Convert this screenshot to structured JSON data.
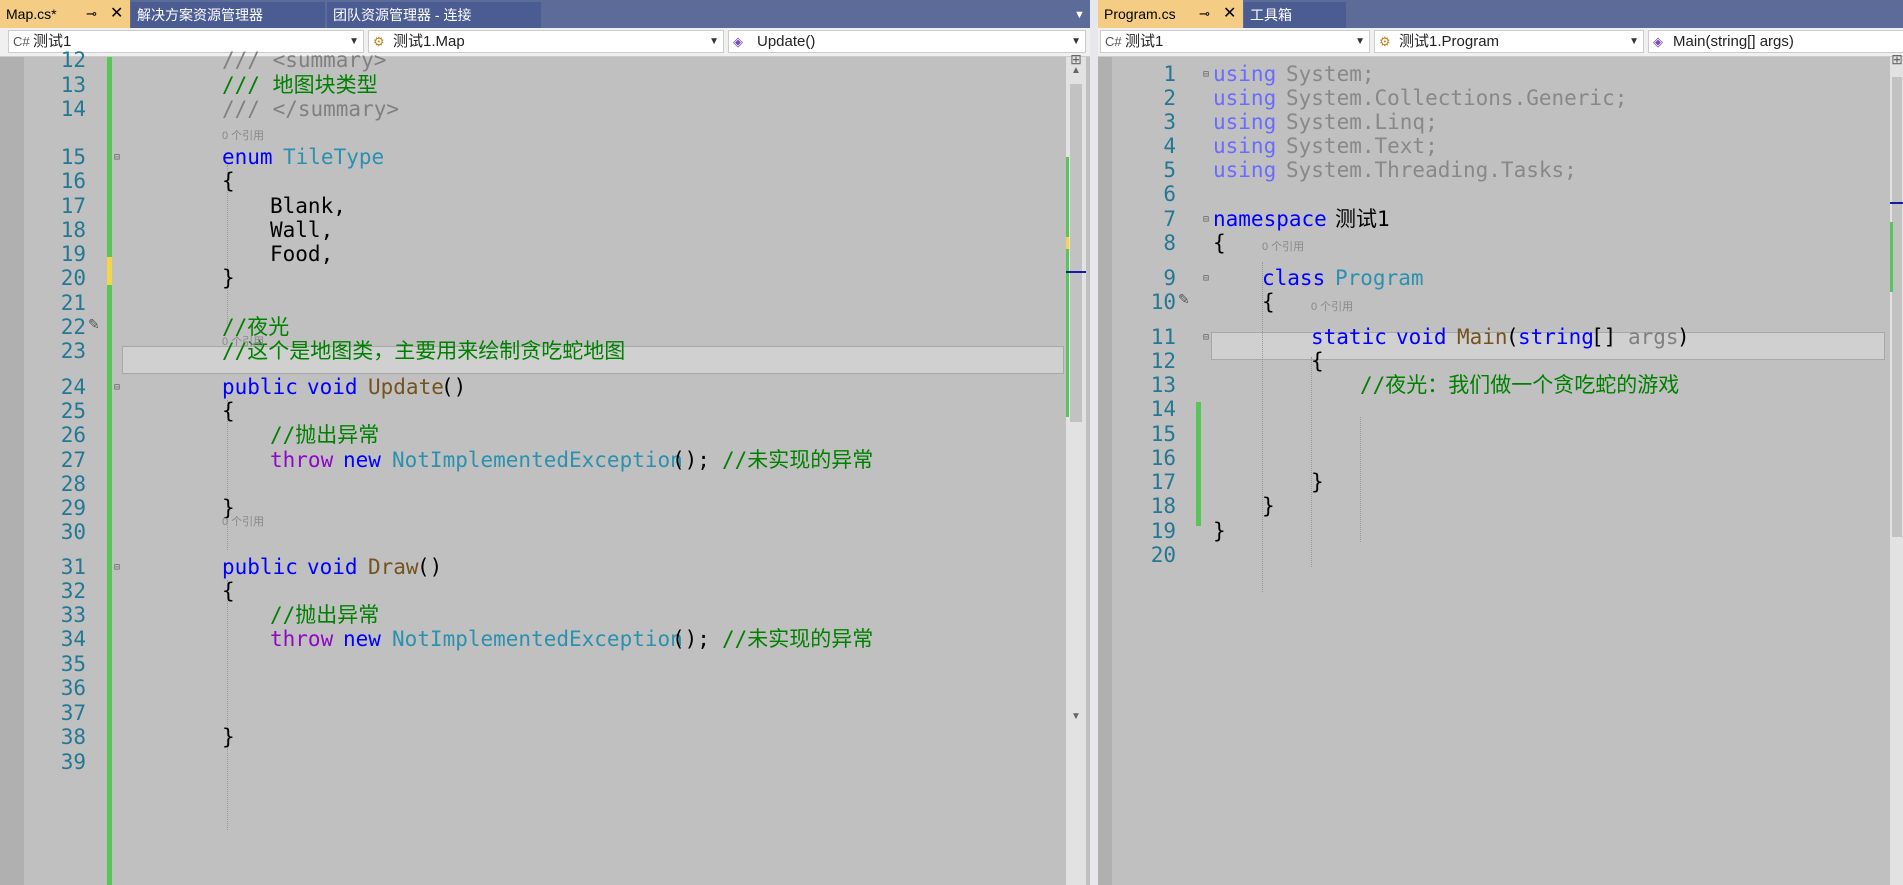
{
  "left_pane": {
    "tabs": [
      {
        "label": "Map.cs*",
        "active": true
      },
      {
        "label": "解决方案资源管理器",
        "active": false
      },
      {
        "label": "团队资源管理器 - 连接",
        "active": false
      }
    ],
    "nav": {
      "project": "测试1",
      "class": "测试1.Map",
      "member": "Update()"
    },
    "lines": [
      {
        "n": "12",
        "text": "/// <summary>"
      },
      {
        "n": "13",
        "text": "/// 地图块类型"
      },
      {
        "n": "14",
        "text": "/// </summary>"
      },
      {
        "n": "15",
        "lens": "0 个引用",
        "kw": "enum",
        "name": "TileType"
      },
      {
        "n": "16",
        "text": "{"
      },
      {
        "n": "17",
        "text": "Blank,"
      },
      {
        "n": "18",
        "text": "Wall,"
      },
      {
        "n": "19",
        "text": "Food,"
      },
      {
        "n": "20",
        "text": "}"
      },
      {
        "n": "21",
        "text": ""
      },
      {
        "n": "22",
        "text": "//夜光"
      },
      {
        "n": "23",
        "text": "//这个是地图类，主要用来绘制贪吃蛇地图"
      },
      {
        "n": "24",
        "lens": "0 个引用",
        "kw1": "public",
        "kw2": "void",
        "fn": "Update",
        "rest": "()"
      },
      {
        "n": "25",
        "text": "{"
      },
      {
        "n": "26",
        "text": "//抛出异常"
      },
      {
        "n": "27",
        "ctl": "throw",
        "kw": "new",
        "ty": "NotImplementedException",
        "rest": "();",
        "cm": "//未实现的异常"
      },
      {
        "n": "28",
        "text": ""
      },
      {
        "n": "29",
        "text": "}"
      },
      {
        "n": "30",
        "text": ""
      },
      {
        "n": "31",
        "lens": "0 个引用",
        "kw1": "public",
        "kw2": "void",
        "fn": "Draw",
        "rest": "()"
      },
      {
        "n": "32",
        "text": "{"
      },
      {
        "n": "33",
        "text": "//抛出异常"
      },
      {
        "n": "34",
        "ctl": "throw",
        "kw": "new",
        "ty": "NotImplementedException",
        "rest": "();",
        "cm": "//未实现的异常"
      },
      {
        "n": "35",
        "text": ""
      },
      {
        "n": "36",
        "text": ""
      },
      {
        "n": "37",
        "text": ""
      },
      {
        "n": "38",
        "text": "}"
      },
      {
        "n": "39",
        "text": ""
      }
    ]
  },
  "right_pane": {
    "tabs": [
      {
        "label": "Program.cs",
        "active": true
      },
      {
        "label": "工具箱",
        "active": false
      }
    ],
    "nav": {
      "project": "测试1",
      "class": "测试1.Program",
      "member": "Main(string[] args)"
    },
    "lines": [
      {
        "n": "1",
        "kw": "using",
        "rest": "System;"
      },
      {
        "n": "2",
        "kw": "using",
        "rest": "System.Collections.Generic;"
      },
      {
        "n": "3",
        "kw": "using",
        "rest": "System.Linq;"
      },
      {
        "n": "4",
        "kw": "using",
        "rest": "System.Text;"
      },
      {
        "n": "5",
        "kw": "using",
        "rest": "System.Threading.Tasks;"
      },
      {
        "n": "6",
        "text": ""
      },
      {
        "n": "7",
        "kw": "namespace",
        "rest": "测试1"
      },
      {
        "n": "8",
        "text": "{"
      },
      {
        "n": "9",
        "lens": "0 个引用",
        "kw": "class",
        "ty": "Program"
      },
      {
        "n": "10",
        "text": "{"
      },
      {
        "n": "11",
        "lens": "0 个引用",
        "kw1": "static",
        "kw2": "void",
        "fn": "Main",
        "p1": "(",
        "kw3": "string",
        "p2": "[]",
        "arg": "args",
        "p3": ")"
      },
      {
        "n": "12",
        "text": "{"
      },
      {
        "n": "13",
        "text": "//夜光：我们做一个贪吃蛇的游戏"
      },
      {
        "n": "14",
        "text": ""
      },
      {
        "n": "15",
        "text": ""
      },
      {
        "n": "16",
        "text": ""
      },
      {
        "n": "17",
        "text": "}"
      },
      {
        "n": "18",
        "text": "}"
      },
      {
        "n": "19",
        "text": "}"
      },
      {
        "n": "20",
        "text": ""
      }
    ]
  },
  "icons": {
    "pin": "pin-icon",
    "close": "close-icon",
    "csharp": "csharp-project-icon",
    "class": "class-icon",
    "method": "method-icon",
    "split": "split-view-icon",
    "pencil": "quick-action-icon"
  },
  "colors": {
    "keyword": "#0000ff",
    "type": "#2b91af",
    "comment": "#008000",
    "method": "#74531f",
    "control": "#8f08c4",
    "line_number": "#237893",
    "change_saved": "#57c557",
    "change_unsaved": "#f3d54a",
    "active_tab": "#f5cc84",
    "tab_bar": "#5d6b99"
  }
}
